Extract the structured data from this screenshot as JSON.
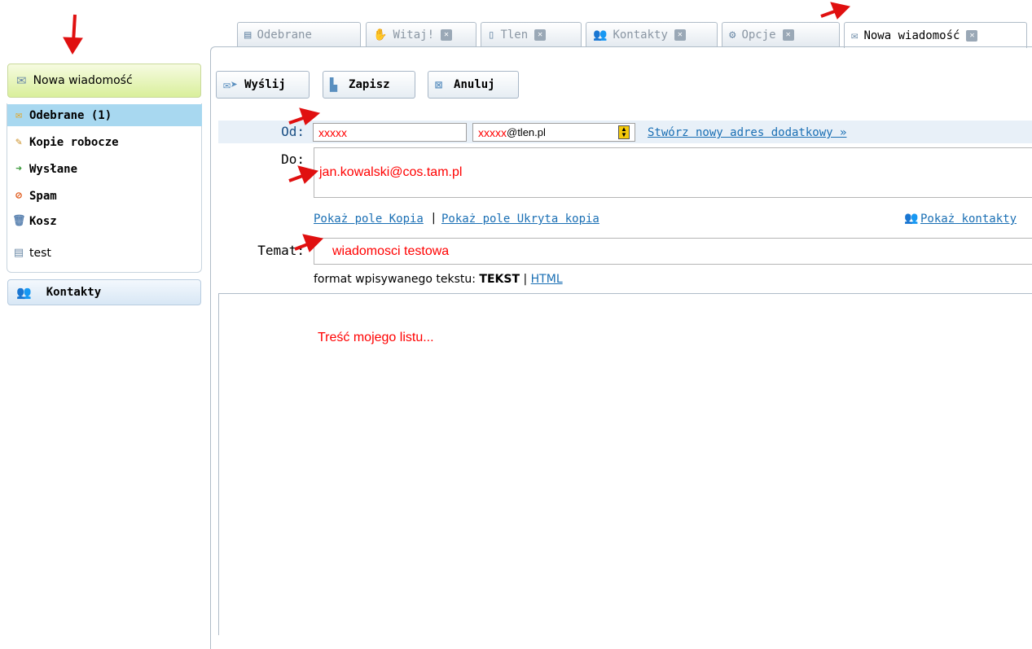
{
  "sidebar": {
    "new_message": "Nowa wiadomość",
    "folders": [
      {
        "label": "Odebrane (1)",
        "icon": "inbox-icon"
      },
      {
        "label": "Kopie robocze",
        "icon": "pencil-icon"
      },
      {
        "label": "Wysłane",
        "icon": "sent-icon"
      },
      {
        "label": "Spam",
        "icon": "spam-icon"
      },
      {
        "label": "Kosz",
        "icon": "trash-icon"
      },
      {
        "label": "test",
        "icon": "folder-icon"
      }
    ],
    "contacts": "Kontakty"
  },
  "tabs": [
    {
      "label": "Odebrane",
      "icon": "inbox-icon"
    },
    {
      "label": "Witaj!",
      "icon": "hand-icon"
    },
    {
      "label": "Tlen",
      "icon": "tlen-icon"
    },
    {
      "label": "Kontakty",
      "icon": "contacts-icon"
    },
    {
      "label": "Opcje",
      "icon": "gears-icon"
    },
    {
      "label": "Nowa wiadomość",
      "icon": "envelope-icon"
    }
  ],
  "toolbar": {
    "send": "Wyślij",
    "save": "Zapisz",
    "cancel": "Anuluj"
  },
  "form": {
    "from_label": "Od:",
    "from_value": "xxxxx",
    "from_select": "xxxxx",
    "from_domain": "@tlen.pl",
    "create_alias": "Stwórz nowy adres dodatkowy »",
    "to_label": "Do:",
    "to_value": "jan.kowalski@cos.tam.pl",
    "show_cc": "Pokaż pole Kopia",
    "show_bcc": "Pokaż pole Ukryta kopia",
    "separator": "|",
    "show_contacts": "Pokaż kontakty",
    "subject_label": "Temat:",
    "subject_value": "wiadomosci testowa",
    "format_label": "format wpisywanego tekstu:",
    "format_text": "TEKST",
    "format_html": "HTML",
    "body": "Treść mojego listu..."
  },
  "colors": {
    "accent_link": "#1a6fb4",
    "annotation_red": "#ff0000",
    "selected_folder": "#a8d8f0"
  }
}
